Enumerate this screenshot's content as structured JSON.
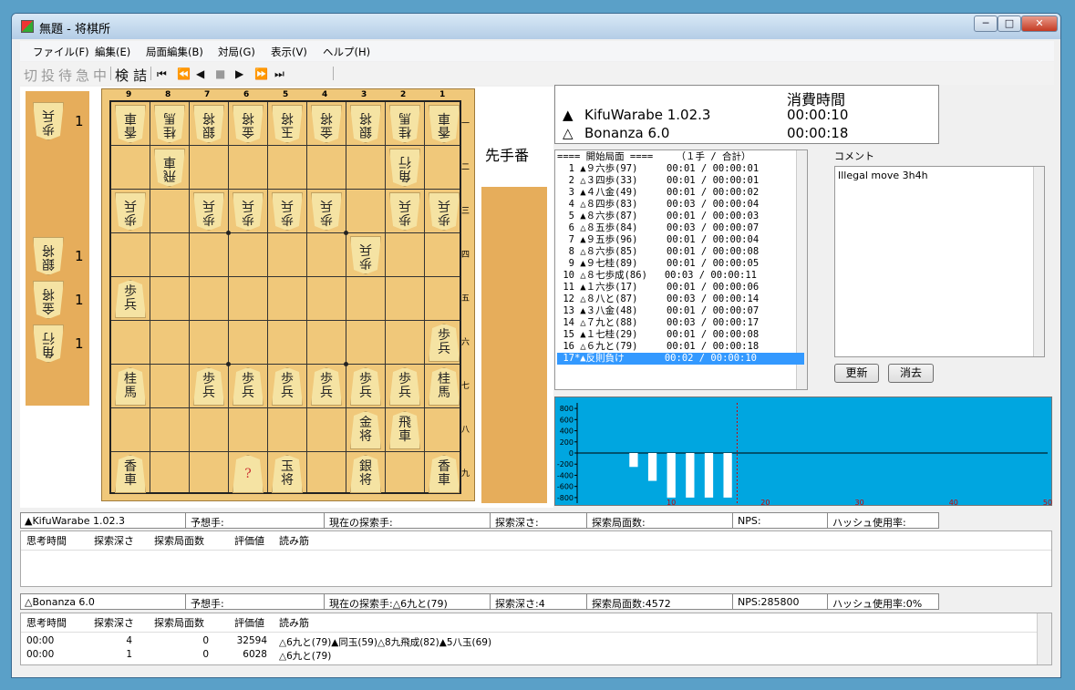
{
  "window": {
    "title": "無題 - 将棋所",
    "min": "─",
    "max": "□",
    "close": "✕"
  },
  "menu": [
    "ファイル(F)",
    "編集(E)",
    "局面編集(B)",
    "対局(G)",
    "表示(V)",
    "ヘルプ(H)"
  ],
  "toolbar": {
    "text_buttons": [
      {
        "label": "切",
        "enabled": false
      },
      {
        "label": "投",
        "enabled": false
      },
      {
        "label": "待",
        "enabled": false
      },
      {
        "label": "急",
        "enabled": false
      },
      {
        "label": "中",
        "enabled": false
      },
      {
        "label": "検",
        "enabled": true
      },
      {
        "label": "詰",
        "enabled": true
      }
    ],
    "nav_buttons": [
      {
        "label": "⏮",
        "icon": "first-move-icon",
        "enabled": true
      },
      {
        "label": "⏪",
        "icon": "back-10-icon",
        "enabled": true
      },
      {
        "label": "◀",
        "icon": "back-icon",
        "enabled": true
      },
      {
        "label": "■",
        "icon": "stop-icon",
        "enabled": false
      },
      {
        "label": "▶",
        "icon": "forward-icon",
        "enabled": true
      },
      {
        "label": "⏩",
        "icon": "forward-10-icon",
        "enabled": true
      },
      {
        "label": "⏭",
        "icon": "last-move-icon",
        "enabled": true
      }
    ]
  },
  "board": {
    "files": [
      "9",
      "8",
      "7",
      "6",
      "5",
      "4",
      "3",
      "2",
      "1"
    ],
    "ranks": [
      "一",
      "二",
      "三",
      "四",
      "五",
      "六",
      "七",
      "八",
      "九"
    ],
    "pieces": [
      {
        "f": 0,
        "r": 0,
        "t": "香車",
        "g": true
      },
      {
        "f": 1,
        "r": 0,
        "t": "桂馬",
        "g": true
      },
      {
        "f": 2,
        "r": 0,
        "t": "銀将",
        "g": true
      },
      {
        "f": 3,
        "r": 0,
        "t": "金将",
        "g": true
      },
      {
        "f": 4,
        "r": 0,
        "t": "玉将",
        "g": true
      },
      {
        "f": 5,
        "r": 0,
        "t": "金将",
        "g": true
      },
      {
        "f": 6,
        "r": 0,
        "t": "銀将",
        "g": true
      },
      {
        "f": 7,
        "r": 0,
        "t": "桂馬",
        "g": true
      },
      {
        "f": 8,
        "r": 0,
        "t": "香車",
        "g": true
      },
      {
        "f": 1,
        "r": 1,
        "t": "飛車",
        "g": true
      },
      {
        "f": 7,
        "r": 1,
        "t": "角行",
        "g": true
      },
      {
        "f": 0,
        "r": 2,
        "t": "歩兵",
        "g": true
      },
      {
        "f": 2,
        "r": 2,
        "t": "歩兵",
        "g": true
      },
      {
        "f": 3,
        "r": 2,
        "t": "歩兵",
        "g": true
      },
      {
        "f": 4,
        "r": 2,
        "t": "歩兵",
        "g": true
      },
      {
        "f": 5,
        "r": 2,
        "t": "歩兵",
        "g": true
      },
      {
        "f": 7,
        "r": 2,
        "t": "歩兵",
        "g": true
      },
      {
        "f": 8,
        "r": 2,
        "t": "歩兵",
        "g": true
      },
      {
        "f": 6,
        "r": 3,
        "t": "歩兵",
        "g": true
      },
      {
        "f": 0,
        "r": 4,
        "t": "歩兵",
        "g": false
      },
      {
        "f": 8,
        "r": 5,
        "t": "歩兵",
        "g": false
      },
      {
        "f": 0,
        "r": 6,
        "t": "桂馬",
        "g": false
      },
      {
        "f": 2,
        "r": 6,
        "t": "歩兵",
        "g": false
      },
      {
        "f": 3,
        "r": 6,
        "t": "歩兵",
        "g": false
      },
      {
        "f": 4,
        "r": 6,
        "t": "歩兵",
        "g": false
      },
      {
        "f": 5,
        "r": 6,
        "t": "歩兵",
        "g": false
      },
      {
        "f": 6,
        "r": 6,
        "t": "歩兵",
        "g": false
      },
      {
        "f": 7,
        "r": 6,
        "t": "歩兵",
        "g": false
      },
      {
        "f": 8,
        "r": 6,
        "t": "桂馬",
        "g": false
      },
      {
        "f": 6,
        "r": 7,
        "t": "金将",
        "g": false
      },
      {
        "f": 7,
        "r": 7,
        "t": "飛車",
        "g": false
      },
      {
        "f": 0,
        "r": 8,
        "t": "香車",
        "g": false
      },
      {
        "f": 3,
        "r": 8,
        "t": "?",
        "g": false,
        "red": true
      },
      {
        "f": 4,
        "r": 8,
        "t": "玉将",
        "g": false
      },
      {
        "f": 6,
        "r": 8,
        "t": "銀将",
        "g": false
      },
      {
        "f": 8,
        "r": 8,
        "t": "香車",
        "g": false
      }
    ]
  },
  "gote_hand": [
    {
      "t": "歩兵",
      "count": "1"
    },
    {
      "t": "銀将",
      "count": "1"
    },
    {
      "t": "金将",
      "count": "1"
    },
    {
      "t": "角行",
      "count": "1"
    }
  ],
  "turn_label": "先手番",
  "time_info": {
    "header": "消費時間",
    "sente_mark": "▲",
    "sente_name": "KifuWarabe 1.02.3",
    "sente_time": "00:00:10",
    "gote_mark": "△",
    "gote_name": "Bonanza 6.0",
    "gote_time": "00:00:18"
  },
  "kifu": {
    "header": "==== 開始局面 ====    （１手 / 合計）",
    "rows": [
      "  1 ▲９六歩(97)     00:01 / 00:00:01",
      "  2 △３四歩(33)     00:01 / 00:00:01",
      "  3 ▲４八金(49)     00:01 / 00:00:02",
      "  4 △８四歩(83)     00:03 / 00:00:04",
      "  5 ▲８六歩(87)     00:01 / 00:00:03",
      "  6 △８五歩(84)     00:03 / 00:00:07",
      "  7 ▲９五歩(96)     00:01 / 00:00:04",
      "  8 △８六歩(85)     00:01 / 00:00:08",
      "  9 ▲９七桂(89)     00:01 / 00:00:05",
      " 10 △８七歩成(86)   00:03 / 00:00:11",
      " 11 ▲１六歩(17)     00:01 / 00:00:06",
      " 12 △８八と(87)     00:03 / 00:00:14",
      " 13 ▲３八金(48)     00:01 / 00:00:07",
      " 14 △７九と(88)     00:03 / 00:00:17",
      " 15 ▲１七桂(29)     00:01 / 00:00:08",
      " 16 △６九と(79)     00:01 / 00:00:18",
      " 17*▲反則負け       00:02 / 00:00:10"
    ],
    "selected_index": 16
  },
  "comment": {
    "label": "コメント",
    "text": "Illegal move 3h4h",
    "update_button": "更新",
    "clear_button": "消去"
  },
  "graph": {
    "y_ticks": [
      "800",
      "600",
      "400",
      "200",
      "0",
      "-200",
      "-400",
      "-600",
      "-800"
    ],
    "x_ticks": [
      "10",
      "20",
      "30",
      "40",
      "50"
    ],
    "background": "#00a6e0"
  },
  "chart_data": {
    "type": "bar",
    "x": [
      6,
      7,
      8,
      9,
      10,
      11,
      12,
      13,
      14,
      15,
      16
    ],
    "values": [
      -250,
      0,
      -500,
      0,
      -800,
      0,
      -800,
      0,
      -800,
      0,
      -800
    ],
    "xlim": [
      0,
      50
    ],
    "ylim": [
      -900,
      900
    ],
    "y_ticks": [
      800,
      600,
      400,
      200,
      0,
      -200,
      -400,
      -600,
      -800
    ],
    "x_ticks": [
      10,
      20,
      30,
      40,
      50
    ],
    "current_move": 17,
    "grid": false
  },
  "sente_status": {
    "name": "▲KifuWarabe 1.02.3",
    "yosou": "予想手:",
    "tansaku": "現在の探索手:",
    "shindo": "探索深さ:",
    "kyokumen": "探索局面数:",
    "nps": "NPS:",
    "hash": "ハッシュ使用率:"
  },
  "gote_status": {
    "name": "△Bonanza 6.0",
    "yosou": "予想手:",
    "tansaku": "現在の探索手:△6九と(79)",
    "shindo": "探索深さ:4",
    "kyokumen": "探索局面数:4572",
    "nps": "NPS:285800",
    "hash": "ハッシュ使用率:0%"
  },
  "pv_headers": [
    "思考時間",
    "探索深さ",
    "探索局面数",
    "評価値",
    "読み筋"
  ],
  "gote_pv_rows": [
    {
      "time": "00:00",
      "depth": "4",
      "nodes": "0",
      "score": "32594",
      "pv": "△6九と(79)▲同玉(59)△8九飛成(82)▲5八玉(69)"
    },
    {
      "time": "00:00",
      "depth": "1",
      "nodes": "0",
      "score": "6028",
      "pv": "△6九と(79)"
    }
  ]
}
